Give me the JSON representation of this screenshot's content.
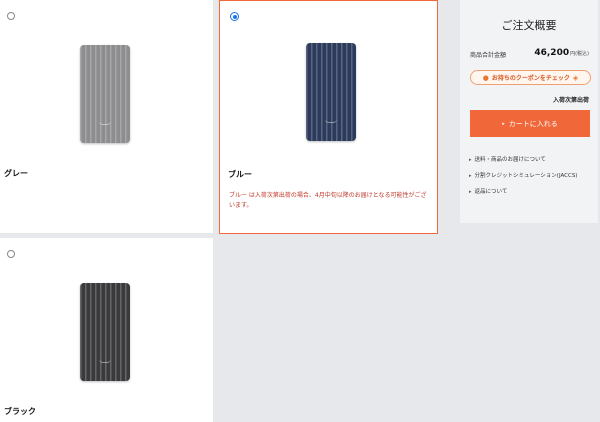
{
  "colors": [
    {
      "name": "グレー",
      "selected": false,
      "swatch": "#8d8d8f"
    },
    {
      "name": "ブルー",
      "selected": true,
      "swatch": "#2c3a5c",
      "note": "ブルー は入荷次第出荷の場合、4月中旬以降のお届けとなる可能性がございます。"
    },
    {
      "name": "ブラック",
      "selected": false,
      "swatch": "#3a3a3c"
    }
  ],
  "summary": {
    "title": "ご注文概要",
    "subtotal_label": "商品合計金額",
    "subtotal_amount": "46,200",
    "tax_label": "円(税込)",
    "coupon_label": "お持ちのクーポンをチェック",
    "stock_status": "入荷次第出荷",
    "cart_button": "カートに入れる",
    "links": [
      "送料・商品のお届けについて",
      "分割クレジットシミュレーション(JACCS)",
      "返品について"
    ]
  },
  "accent_color": "#f0683a",
  "selection_color": "#1a73e8"
}
